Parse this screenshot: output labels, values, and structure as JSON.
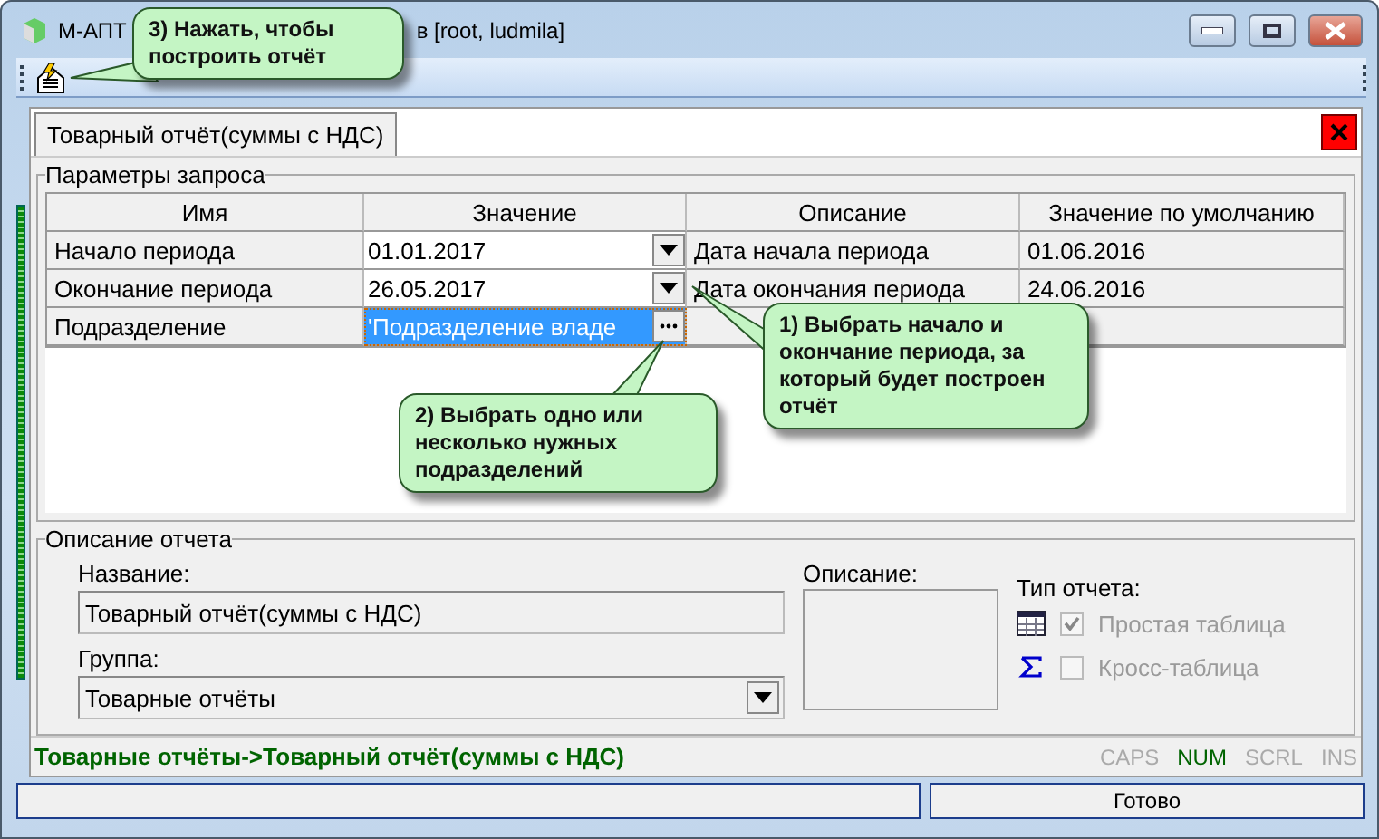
{
  "window": {
    "title_start": "М-АПТ",
    "title_end": "в [root, ludmila]"
  },
  "tab": {
    "label": "Товарный отчёт(суммы с НДС)",
    "selected": true
  },
  "params": {
    "title": "Параметры запроса",
    "columns": [
      "Имя",
      "Значение",
      "Описание",
      "Значение по умолчанию"
    ],
    "rows": [
      {
        "name": "Начало периода",
        "value": "01.01.2017",
        "kind": "date",
        "selected": false,
        "description": "Дата начала периода",
        "default": "01.06.2016"
      },
      {
        "name": "Окончание периода",
        "value": "26.05.2017",
        "kind": "date",
        "selected": false,
        "description": "Дата окончания периода",
        "default": "24.06.2016"
      },
      {
        "name": "Подразделение",
        "value": "'Подразделение владе",
        "kind": "picker",
        "selected": true
      }
    ]
  },
  "report": {
    "title": "Описание отчета",
    "name_label": "Название:",
    "name": "Товарный отчёт(суммы с НДС)",
    "group_label": "Группа:",
    "group": "Товарные отчёты",
    "description_label": "Описание:",
    "type_label": "Тип отчета:",
    "types": [
      {
        "label": "Простая таблица",
        "checked": true,
        "kind": "table"
      },
      {
        "label": "Кросс-таблица",
        "checked": false,
        "kind": "sigma"
      }
    ]
  },
  "path": "Товарные отчёты->Товарный отчёт(суммы с НДС)",
  "indicators": [
    {
      "label": "CAPS",
      "on": false
    },
    {
      "label": "NUM",
      "on": true
    },
    {
      "label": "SCRL",
      "on": false
    },
    {
      "label": "INS",
      "on": false
    }
  ],
  "status_bar": {
    "text": "Готово"
  },
  "callouts": [
    {
      "text": "3) Нажать, чтобы построить отчёт"
    },
    {
      "text": "1) Выбрать начало и окончание периода, за который будет построен отчёт"
    },
    {
      "text": "2) Выбрать одно или несколько нужных подразделений"
    }
  ]
}
